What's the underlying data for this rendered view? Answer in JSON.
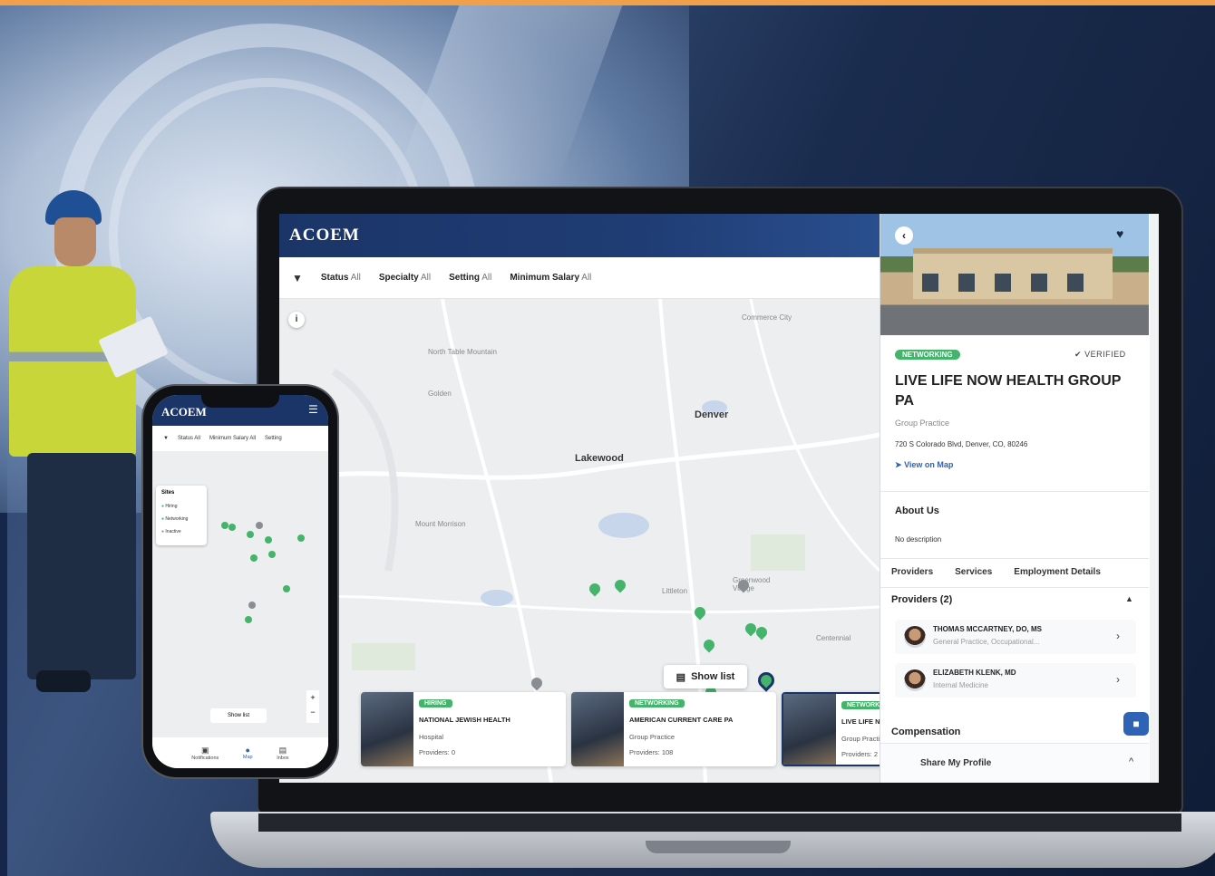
{
  "app": {
    "logo": "ACOEM"
  },
  "filters": [
    {
      "label": "Status",
      "value": "All"
    },
    {
      "label": "Specialty",
      "value": "All"
    },
    {
      "label": "Setting",
      "value": "All"
    },
    {
      "label": "Minimum Salary",
      "value": "All"
    }
  ],
  "map": {
    "cities": {
      "denver": "Denver",
      "lakewood": "Lakewood"
    },
    "towns": {
      "commerce_city": "Commerce City",
      "north_table": "North Table Mountain",
      "golden": "Golden",
      "mount_morrison": "Mount Morrison",
      "littleton": "Littleton",
      "greenwood": "Greenwood Village",
      "centennial": "Centennial"
    },
    "show_list_label": "Show list"
  },
  "cards": [
    {
      "tag": "HIRING",
      "name": "NATIONAL JEWISH HEALTH",
      "type": "Hospital",
      "providers": "Providers: 0"
    },
    {
      "tag": "NETWORKING",
      "name": "AMERICAN CURRENT CARE PA",
      "type": "Group Practice",
      "providers": "Providers: 108"
    },
    {
      "tag": "NETWORKING",
      "name": "LIVE LIFE NOW HEALTH GROUP PA",
      "type": "Group Practice",
      "providers": "Providers: 2"
    }
  ],
  "detail": {
    "status_tag": "NETWORKING",
    "verified": "VERIFIED",
    "title": "LIVE LIFE NOW HEALTH GROUP PA",
    "type": "Group Practice",
    "address": "720 S Colorado Blvd, Denver, CO, 80246",
    "view_on_map": "View on Map",
    "about_heading": "About Us",
    "about_text": "No description",
    "tabs": [
      "Providers",
      "Services",
      "Employment Details"
    ],
    "providers_heading": "Providers (2)",
    "providers": [
      {
        "name": "THOMAS MCCARTNEY, DO, MS",
        "specialty": "General Practice, Occupational..."
      },
      {
        "name": "ELIZABETH KLENK, MD",
        "specialty": "Internal Medicine"
      }
    ],
    "compensation_heading": "Compensation",
    "share_label": "Share My Profile"
  },
  "phone": {
    "logo": "ACOEM",
    "filters": [
      "Status All",
      "Minimum Salary All",
      "Setting"
    ],
    "legend": {
      "heading": "Sites",
      "items": [
        "Hiring",
        "Networking",
        "Inactive"
      ]
    },
    "show_list_label": "Show list",
    "nav": [
      "Notifications",
      "Map",
      "Inbox"
    ]
  },
  "colors": {
    "brand_navy": "#1b3568",
    "accent_green": "#44b36b",
    "link_blue": "#2f63b5",
    "top_strip": "#f0a04a"
  }
}
